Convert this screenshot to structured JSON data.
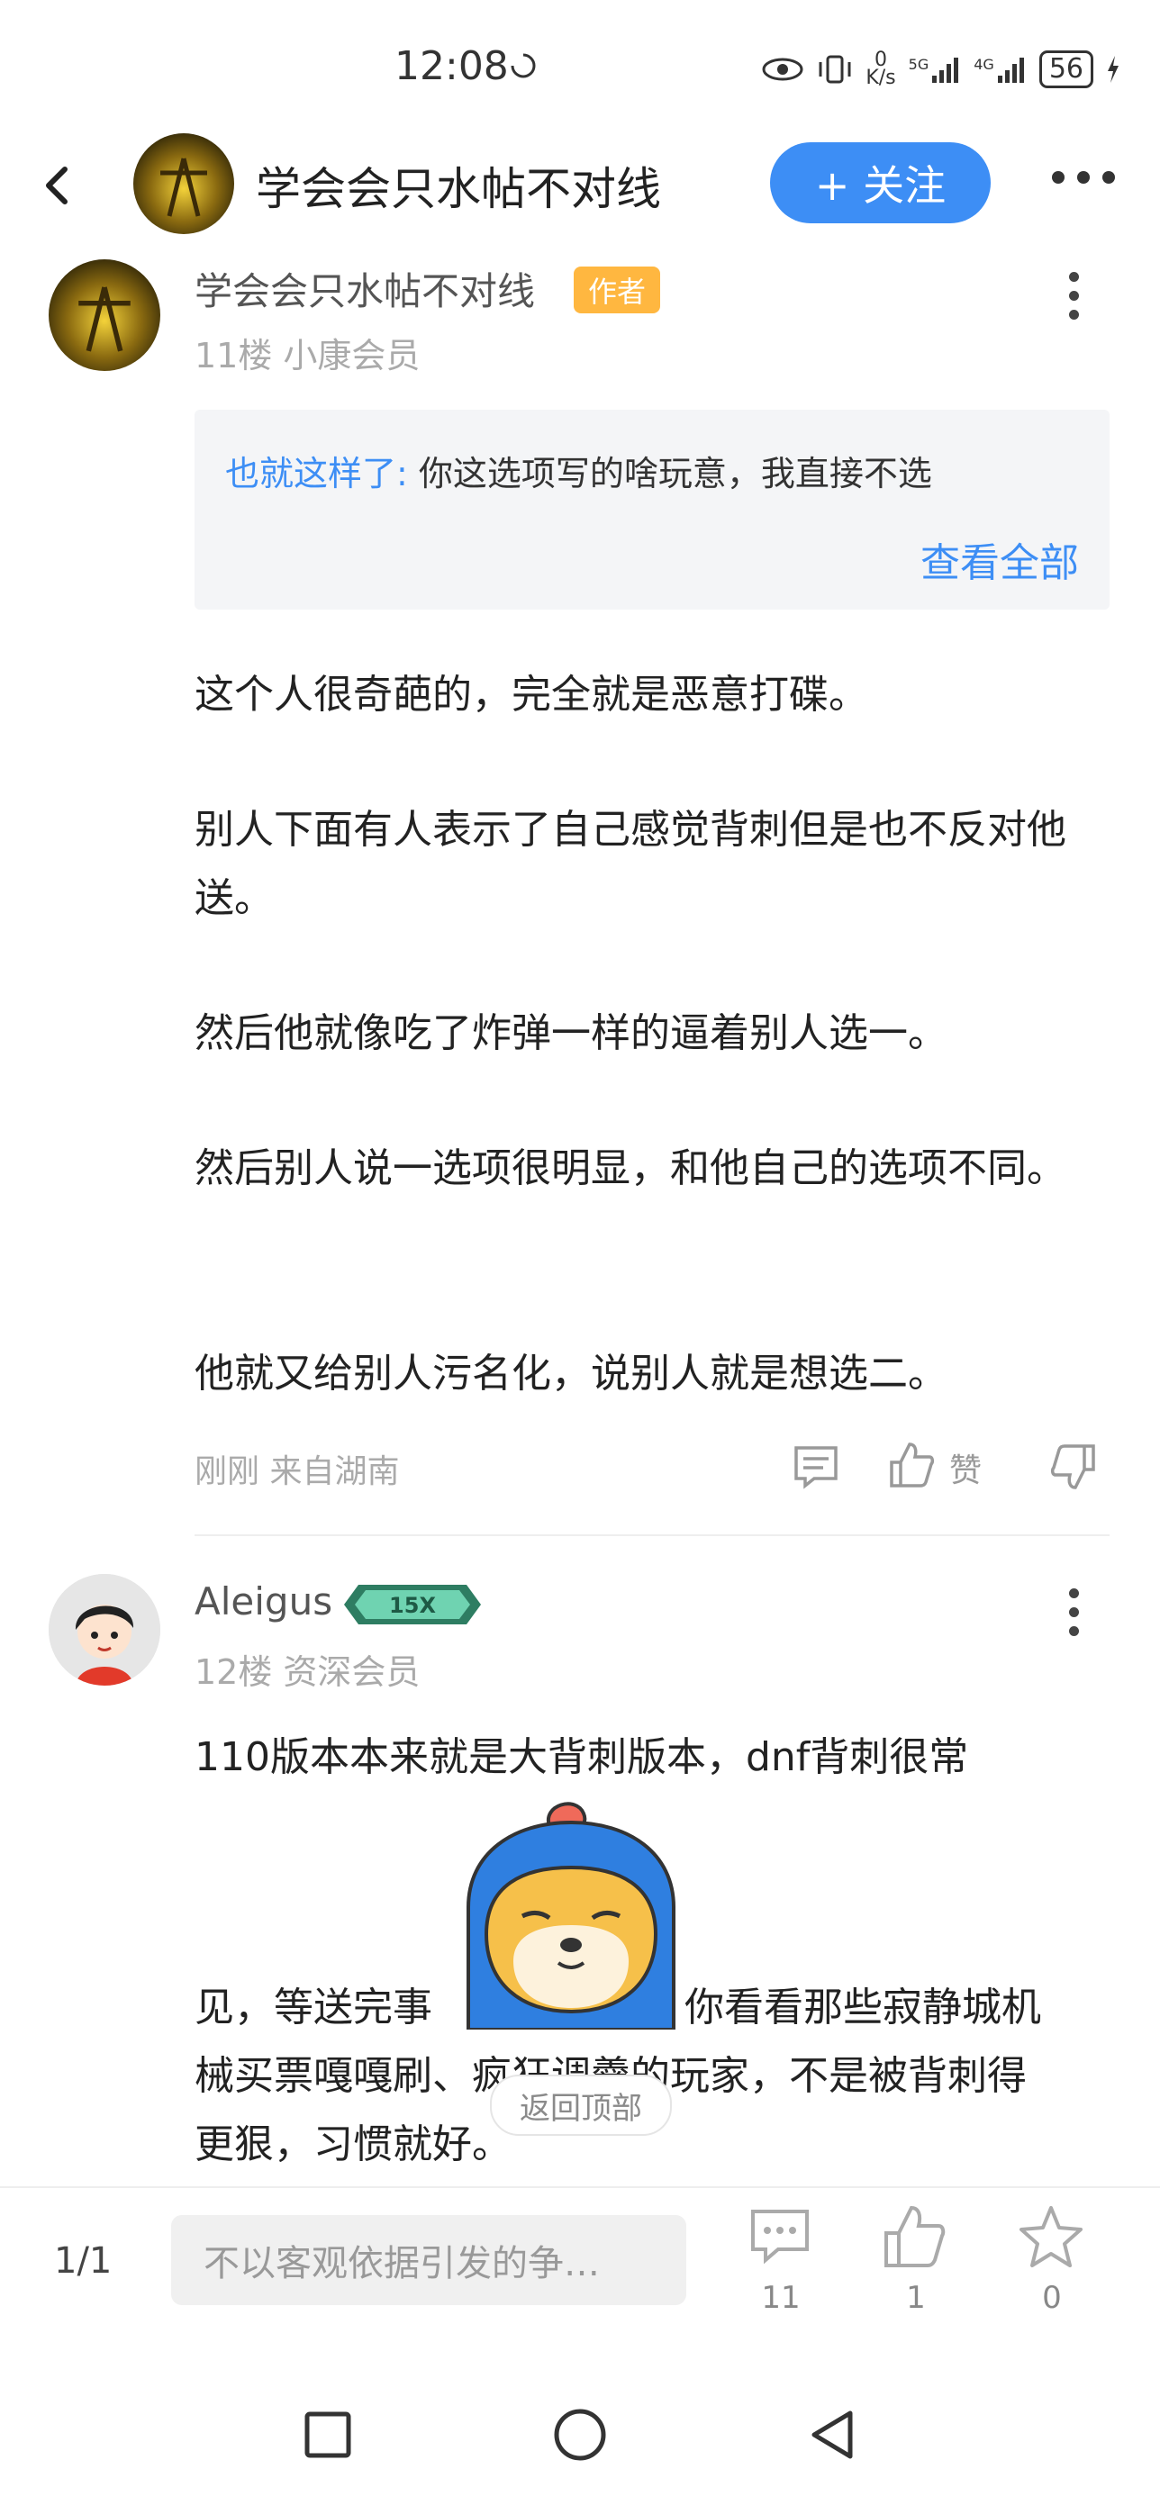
{
  "status_bar": {
    "time": "12:08",
    "net_speed_value": "0",
    "net_speed_unit": "K/s",
    "signal_1": "5G",
    "signal_2": "4G",
    "battery": "56"
  },
  "header": {
    "title": "学会会只水帖不对线",
    "follow_label": "+ 关注"
  },
  "post": {
    "author": "学会会只水帖不对线",
    "author_badge": "作者",
    "floor": "11楼 小康会员",
    "quote": {
      "user": "也就这样了:",
      "text": " 你这选项写的啥玩意，我直接不选",
      "more": "查看全部"
    },
    "paragraphs": [
      "这个人很奇葩的，完全就是恶意打碟。",
      "别人下面有人表示了自己感觉背刺但是也不反对他送。",
      "然后他就像吃了炸弹一样的逼着别人选一。",
      "然后别人说一选项很明显，和他自己的选项不同。",
      "他就又给别人污名化，说别人就是想选二。"
    ],
    "time_location": "刚刚 来自湖南",
    "like_label": "赞"
  },
  "post2": {
    "author": "Aleigus",
    "level_badge": "15X",
    "floor": "12楼 资深会员",
    "line1": "110版本本来就是大背刺版本，dnf背刺很常",
    "line2_a": "见，等送完事",
    "line2_b": "你看看那些寂静城机",
    "line3": "械买票嘎嘎刷、疯狂调羹的玩家，不是被背刺得",
    "line4": "更狠，习惯就好。"
  },
  "back_to_top": "返回顶部",
  "bottom_bar": {
    "page": "1/1",
    "reply_placeholder": "不以客观依据引发的争…",
    "comments": "11",
    "likes": "1",
    "favorites": "0"
  },
  "colors": {
    "accent": "#3d8ef5",
    "author_badge": "#ffb740"
  }
}
